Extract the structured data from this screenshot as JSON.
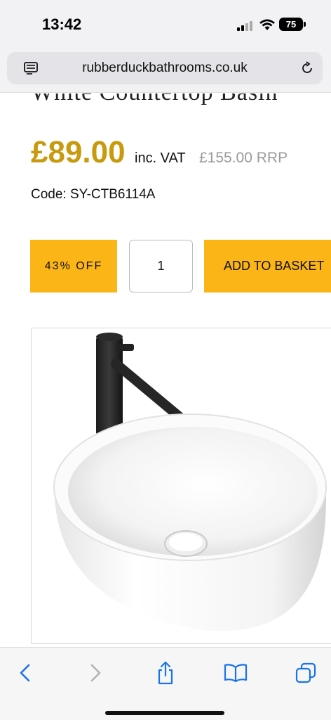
{
  "status_bar": {
    "time": "13:42",
    "battery": "75",
    "icons": [
      "signal-icon",
      "wifi-icon",
      "battery-icon"
    ]
  },
  "browser": {
    "url": "rubberduckbathrooms.co.uk",
    "icons": [
      "reader-icon",
      "reload-icon"
    ]
  },
  "product": {
    "title_partial": "White Countertop Basin",
    "price": "£89.00",
    "vat_label": "inc. VAT",
    "rrp": "£155.00 RRP",
    "code": "Code: SY-CTB6114A",
    "discount": "43% OFF",
    "quantity": "1",
    "add_to_basket": "ADD TO BASKET"
  },
  "toolbar": {
    "icons": [
      "back-icon",
      "forward-icon",
      "share-icon",
      "bookmarks-icon",
      "tabs-icon"
    ]
  },
  "colors": {
    "accent": "#fbb516",
    "price": "#c99a0e",
    "rrp": "#9a9a9a",
    "ios_blue": "#1a73e8"
  }
}
